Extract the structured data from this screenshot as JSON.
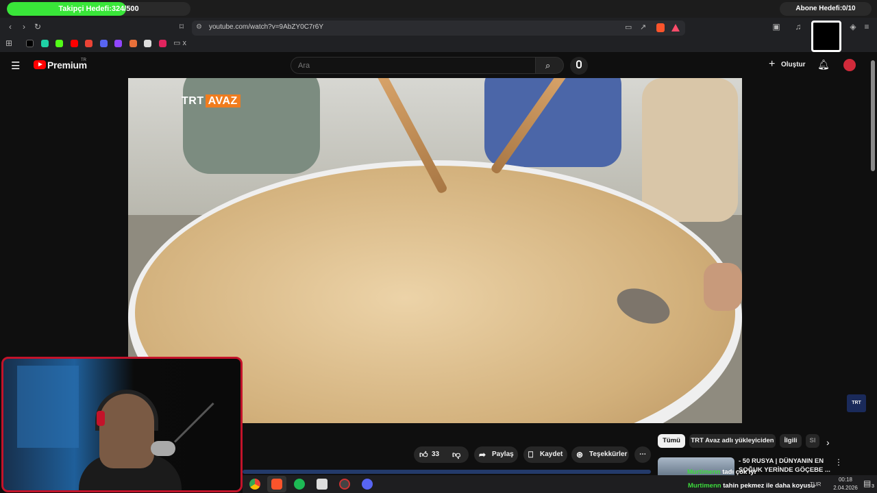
{
  "overlay": {
    "follower_goal": "Takipçi Hedefi:324/500",
    "follower_progress": 0.648,
    "sub_goal": "Abone Hedefi:0/10"
  },
  "browser": {
    "url": "youtube.com/watch?v=9AbZY0C7r6Y",
    "bookmark_folder_label": "x"
  },
  "youtube": {
    "logo_text": "Premium",
    "logo_sup": "TR",
    "search_placeholder": "Ara",
    "create_label": "Oluştur"
  },
  "video": {
    "watermark_trt": "TRT",
    "watermark_avaz": "AVAZ",
    "corner_logo": "TRT"
  },
  "actions": {
    "like_count": "33",
    "share": "Paylaş",
    "save": "Kaydet",
    "thanks": "Teşekkürler"
  },
  "chips": [
    "Tümü",
    "TRT Avaz adlı yükleyiciden",
    "İlgili",
    "Sl"
  ],
  "suggestion": {
    "title_line1": "- 50 RUSYA | DÜNYANIN EN",
    "title_line2": "SOĞUK YERİNDE GÖÇEBE ..."
  },
  "chat": {
    "msg1_user": "Murtimenn",
    "msg1_text": "tadı çok iyi",
    "msg2_user": "Murtimenn",
    "msg2_text": "tahin pekmez ile daha koyusu"
  },
  "taskbar": {
    "lang": "TUR",
    "time": "00:18",
    "date": "2.04.2026",
    "notif_count": "3"
  },
  "colors": {
    "follower_fill": "#39e639",
    "webcam_border": "#c3132a",
    "youtube_red": "#ff0000",
    "chat_user": "#3ddc3d"
  }
}
